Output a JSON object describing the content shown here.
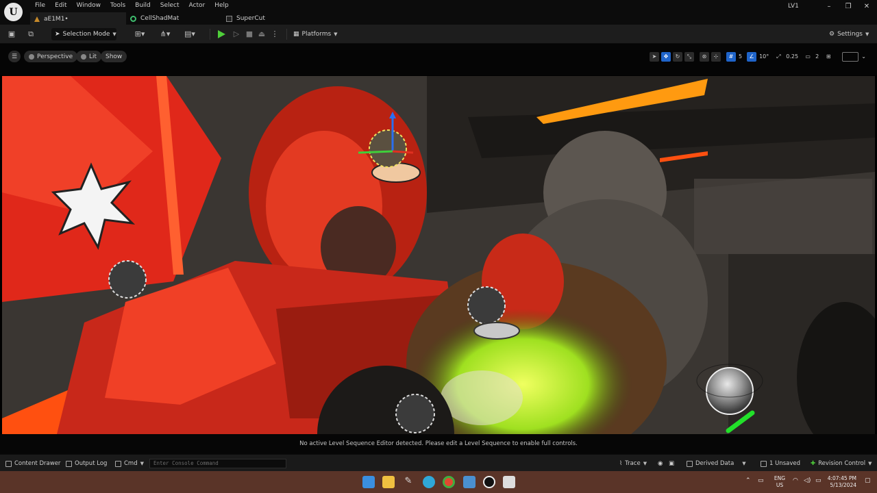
{
  "app": {
    "logo_letter": "U",
    "title": "LV1"
  },
  "menu": [
    "File",
    "Edit",
    "Window",
    "Tools",
    "Build",
    "Select",
    "Actor",
    "Help"
  ],
  "tabs": [
    {
      "label": "aE1M1•",
      "icon": "level-icon"
    },
    {
      "label": "CellShadMat",
      "icon": "material-icon"
    },
    {
      "label": "SuperCut",
      "icon": "sequence-icon"
    }
  ],
  "window_controls": {
    "minimize": "–",
    "maximize": "❐",
    "close": "✕"
  },
  "toolbar": {
    "selection_mode": "Selection Mode",
    "platforms": "Platforms",
    "settings": "Settings"
  },
  "viewport": {
    "perspective": "Perspective",
    "lit": "Lit",
    "show": "Show",
    "grid_snap": "5",
    "rotation_snap": "10°",
    "scale_snap": "0.25",
    "camera_speed": "2",
    "sequence_message": "No active Level Sequence Editor detected. Please edit a Level Sequence to enable full controls."
  },
  "statusbar": {
    "content_drawer": "Content Drawer",
    "output_log": "Output Log",
    "cmd": "Cmd",
    "console_placeholder": "Enter Console Command",
    "trace": "Trace",
    "derived_data": "Derived Data",
    "unsaved": "1 Unsaved",
    "revision_control": "Revision Control"
  },
  "taskbar": {
    "lang_line1": "ENG",
    "lang_line2": "US",
    "time": "4:07:45 PM",
    "date": "5/13/2024"
  },
  "colors": {
    "accent_blue": "#1f64c9",
    "play_green": "#4fcf3a",
    "scene_red": "#e0281a",
    "scene_orange": "#ff8a10",
    "scene_yellow": "#d8f020",
    "taskbar_bg": "#5a3428"
  }
}
